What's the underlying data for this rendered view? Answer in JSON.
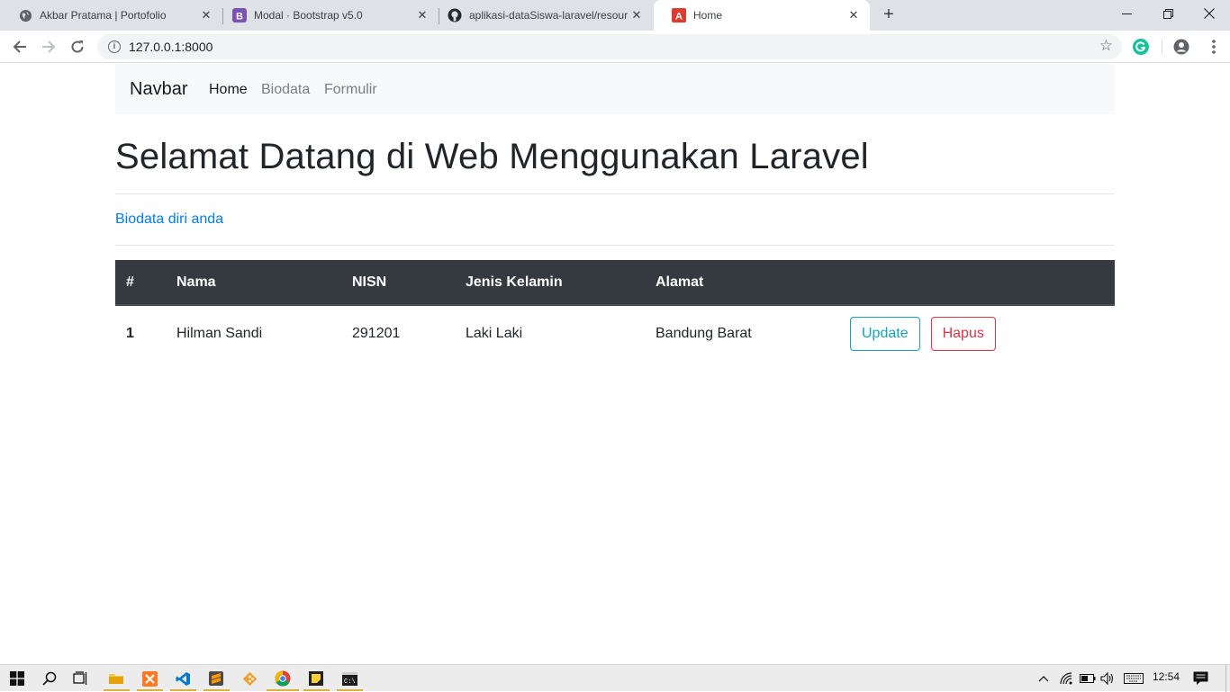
{
  "browser": {
    "tabs": [
      {
        "title": "Akbar Pratama | Portofolio",
        "icon": "globe-icon"
      },
      {
        "title": "Modal · Bootstrap v5.0",
        "icon": "bootstrap-icon"
      },
      {
        "title": "aplikasi-dataSiswa-laravel/resour",
        "icon": "github-icon"
      },
      {
        "title": "Home",
        "icon": "laravel-icon"
      }
    ],
    "active_tab": 3,
    "url": "127.0.0.1:8000"
  },
  "navbar": {
    "brand": "Navbar",
    "links": [
      {
        "label": "Home",
        "active": true
      },
      {
        "label": "Biodata",
        "active": false
      },
      {
        "label": "Formulir",
        "active": false
      }
    ]
  },
  "page": {
    "heading": "Selamat Datang di Web Menggunakan Laravel",
    "biodata_link": "Biodata diri anda"
  },
  "table": {
    "headers": [
      "#",
      "Nama",
      "NISN",
      "Jenis Kelamin",
      "Alamat",
      ""
    ],
    "rows": [
      {
        "no": "1",
        "nama": "Hilman Sandi",
        "nisn": "291201",
        "jenis_kelamin": "Laki Laki",
        "alamat": "Bandung Barat"
      }
    ],
    "update_label": "Update",
    "delete_label": "Hapus"
  },
  "taskbar": {
    "apps": [
      "file-explorer-icon",
      "xampp-icon",
      "vscode-icon",
      "sublime-icon",
      "git-icon",
      "chrome-icon",
      "sticky-notes-icon",
      "terminal-icon"
    ],
    "clock": "12:54"
  },
  "colors": {
    "primary": "#007bff",
    "info": "#17a2b8",
    "danger": "#dc3545",
    "table_head": "#343a40"
  }
}
